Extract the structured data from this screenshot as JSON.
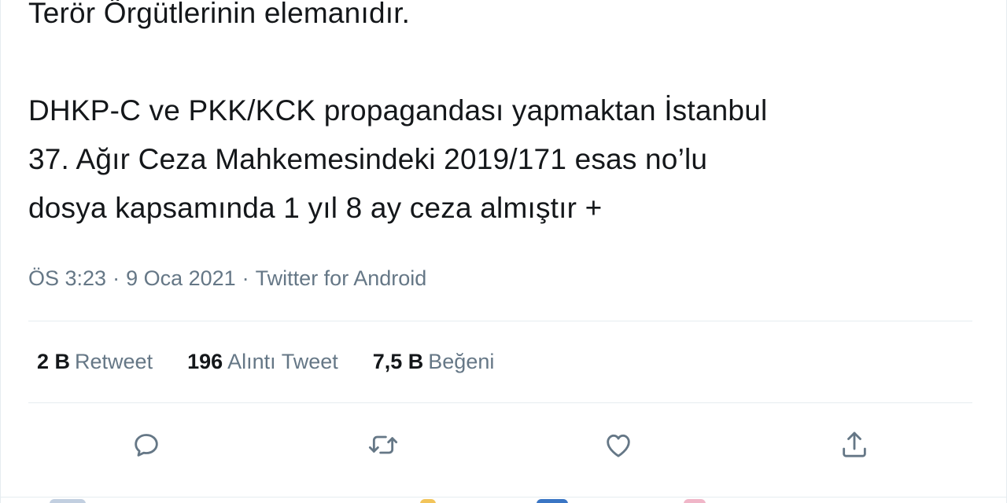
{
  "tweet": {
    "lines": [
      "Terör Örgütlerinin elemanıdır.",
      "DHKP-C ve PKK/KCK propagandası yapmaktan İstanbul",
      "37. Ağır Ceza Mahkemesindeki 2019/171 esas no’lu",
      "dosya kapsamında 1 yıl 8 ay ceza almıştır +"
    ],
    "time": "ÖS 3:23",
    "date": "9 Oca 2021",
    "separator": "·",
    "source": "Twitter for Android"
  },
  "stats": {
    "retweets": {
      "count": "2 B",
      "label": "Retweet"
    },
    "quotes": {
      "count": "196",
      "label": "Alıntı Tweet"
    },
    "likes": {
      "count": "7,5 B",
      "label": "Beğeni"
    }
  },
  "actions": {
    "reply": "reply-icon",
    "retweet": "retweet-icon",
    "like": "heart-icon",
    "share": "share-icon"
  },
  "colors": {
    "text": "#14171a",
    "secondary": "#657786",
    "border": "#e6ecf0"
  }
}
